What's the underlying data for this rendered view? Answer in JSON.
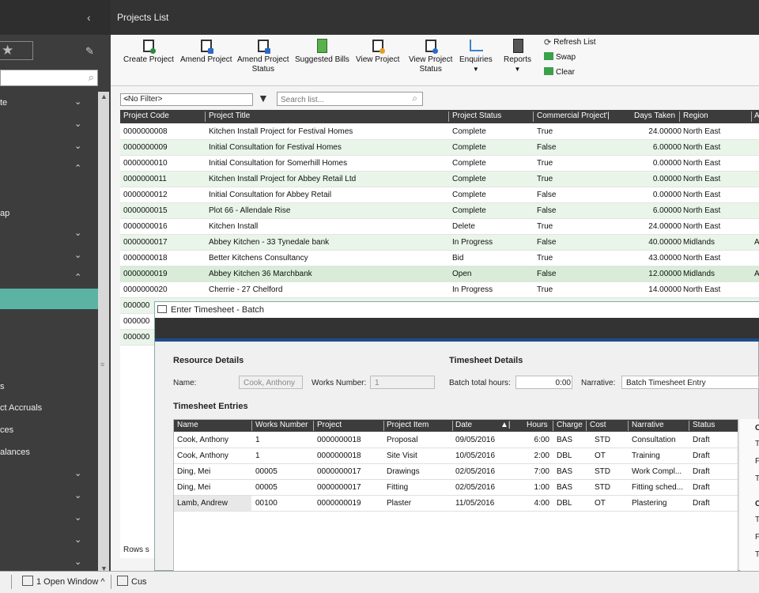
{
  "sidebar": {
    "collapse_icon": "chevron-left-icon",
    "search_value": "",
    "items": [
      {
        "label": "te",
        "chevron": "⌄"
      },
      {
        "label": "",
        "chevron": "⌄"
      },
      {
        "label": "",
        "chevron": "⌄"
      },
      {
        "label": "",
        "chevron": "⌃"
      },
      {
        "label": "ap",
        "chevron": ""
      },
      {
        "label": "",
        "chevron": "⌄"
      },
      {
        "label": "",
        "chevron": "⌄"
      },
      {
        "label": "",
        "chevron": "⌃"
      },
      {
        "label": "s",
        "chevron": ""
      },
      {
        "label": "ct Accruals",
        "chevron": ""
      },
      {
        "label": "ces",
        "chevron": ""
      },
      {
        "label": "alances",
        "chevron": ""
      },
      {
        "label": "",
        "chevron": "⌄"
      },
      {
        "label": "",
        "chevron": "⌄"
      },
      {
        "label": "",
        "chevron": "⌄"
      },
      {
        "label": "",
        "chevron": "⌄"
      },
      {
        "label": "",
        "chevron": "⌄"
      }
    ],
    "accent": "#5ab3a3"
  },
  "taskbar": {
    "open_windows": "1 Open Window ^",
    "cus": "Cus"
  },
  "main": {
    "title": "Projects List",
    "ribbon": {
      "create": "Create Project",
      "amend": "Amend Project",
      "amend_status_1": "Amend Project",
      "amend_status_2": "Status",
      "suggested_bills": "Suggested Bills",
      "view": "View Project",
      "view_status_1": "View Project",
      "view_status_2": "Status",
      "enquiries": "Enquiries",
      "reports": "Reports",
      "refresh": "Refresh List",
      "swap": "Swap",
      "clear": "Clear"
    },
    "filter": {
      "selected": "<No Filter>",
      "search_placeholder": "Search list..."
    },
    "columns": [
      "Project Code",
      "Project Title",
      "Project Status",
      "Commercial Project'|",
      "Days Taken",
      "Region",
      "A"
    ],
    "rows": [
      {
        "code": "0000000008",
        "title": "Kitchen Install Project for Festival Homes",
        "status": "Complete",
        "commercial": "True",
        "days": "24.00000",
        "region": "North East",
        "a": ""
      },
      {
        "code": "0000000009",
        "title": "Initial Consultation for Festival Homes",
        "status": "Complete",
        "commercial": "False",
        "days": "6.00000",
        "region": "North East",
        "a": ""
      },
      {
        "code": "0000000010",
        "title": "Initial Consultation for Somerhill Homes",
        "status": "Complete",
        "commercial": "True",
        "days": "0.00000",
        "region": "North East",
        "a": ""
      },
      {
        "code": "0000000011",
        "title": "Kitchen Install Project for Abbey Retail Ltd",
        "status": "Complete",
        "commercial": "True",
        "days": "0.00000",
        "region": "North East",
        "a": ""
      },
      {
        "code": "0000000012",
        "title": "Initial Consultation for Abbey Retail",
        "status": "Complete",
        "commercial": "False",
        "days": "0.00000",
        "region": "North East",
        "a": ""
      },
      {
        "code": "0000000015",
        "title": "Plot 66 - Allendale Rise",
        "status": "Complete",
        "commercial": "False",
        "days": "6.00000",
        "region": "North East",
        "a": ""
      },
      {
        "code": "0000000016",
        "title": "Kitchen Install",
        "status": "Delete",
        "commercial": "True",
        "days": "24.00000",
        "region": "North East",
        "a": ""
      },
      {
        "code": "0000000017",
        "title": "Abbey Kitchen - 33 Tynedale bank",
        "status": "In Progress",
        "commercial": "False",
        "days": "40.00000",
        "region": "Midlands",
        "a": "A"
      },
      {
        "code": "0000000018",
        "title": "Better Kitchens Consultancy",
        "status": "Bid",
        "commercial": "True",
        "days": "43.00000",
        "region": "North East",
        "a": ""
      },
      {
        "code": "0000000019",
        "title": "Abbey Kitchen 36 Marchbank",
        "status": "Open",
        "commercial": "False",
        "days": "12.00000",
        "region": "Midlands",
        "a": "A"
      },
      {
        "code": "0000000020",
        "title": "Cherrie - 27 Chelford",
        "status": "In Progress",
        "commercial": "True",
        "days": "14.00000",
        "region": "North East",
        "a": ""
      },
      {
        "code": "000000",
        "title": "",
        "status": "",
        "commercial": "",
        "days": "",
        "region": "",
        "a": ""
      },
      {
        "code": "000000",
        "title": "",
        "status": "",
        "commercial": "",
        "days": "",
        "region": "",
        "a": ""
      },
      {
        "code": "000000",
        "title": "",
        "status": "",
        "commercial": "",
        "days": "",
        "region": "",
        "a": ""
      }
    ],
    "footer": "Rows s"
  },
  "dialog": {
    "title": "Enter Timesheet - Batch",
    "resource_heading": "Resource Details",
    "name_label": "Name:",
    "name_value": "Cook, Anthony",
    "works_label": "Works Number:",
    "works_value": "1",
    "timesheet_heading": "Timesheet Details",
    "batch_label": "Batch total hours:",
    "batch_value": "0:00",
    "narrative_label": "Narrative:",
    "narrative_value": "Batch Timesheet Entry",
    "entries_heading": "Timesheet Entries",
    "columns": [
      "Name",
      "Works Number",
      "Project",
      "Project Item",
      "Date",
      "Hours",
      "Charge",
      "Cost",
      "Narrative",
      "Status"
    ],
    "sort_icon": "▲|",
    "rows": [
      {
        "name": "Cook, Anthony",
        "works": "1",
        "project": "0000000018",
        "item": "Proposal",
        "date": "09/05/2016",
        "hours": "6:00",
        "charge": "BAS",
        "cost": "STD",
        "narrative": "Consultation",
        "status": "Draft"
      },
      {
        "name": "Cook, Anthony",
        "works": "1",
        "project": "0000000018",
        "item": "Site Visit",
        "date": "10/05/2016",
        "hours": "2:00",
        "charge": "DBL",
        "cost": "OT",
        "narrative": "Training",
        "status": "Draft"
      },
      {
        "name": "Ding, Mei",
        "works": "00005",
        "project": "0000000017",
        "item": "Drawings",
        "date": "02/05/2016",
        "hours": "7:00",
        "charge": "BAS",
        "cost": "STD",
        "narrative": "Work Compl...",
        "status": "Draft"
      },
      {
        "name": "Ding, Mei",
        "works": "00005",
        "project": "0000000017",
        "item": "Fitting",
        "date": "02/05/2016",
        "hours": "1:00",
        "charge": "BAS",
        "cost": "STD",
        "narrative": "Fitting sched...",
        "status": "Draft"
      },
      {
        "name": "Lamb, Andrew",
        "works": "00100",
        "project": "0000000019",
        "item": "Plaster",
        "date": "11/05/2016",
        "hours": "4:00",
        "charge": "DBL",
        "cost": "OT",
        "narrative": "Plastering",
        "status": "Draft"
      }
    ],
    "side_letters": [
      "C",
      "T",
      "F",
      "T",
      "C",
      "T",
      "F",
      "T"
    ]
  }
}
